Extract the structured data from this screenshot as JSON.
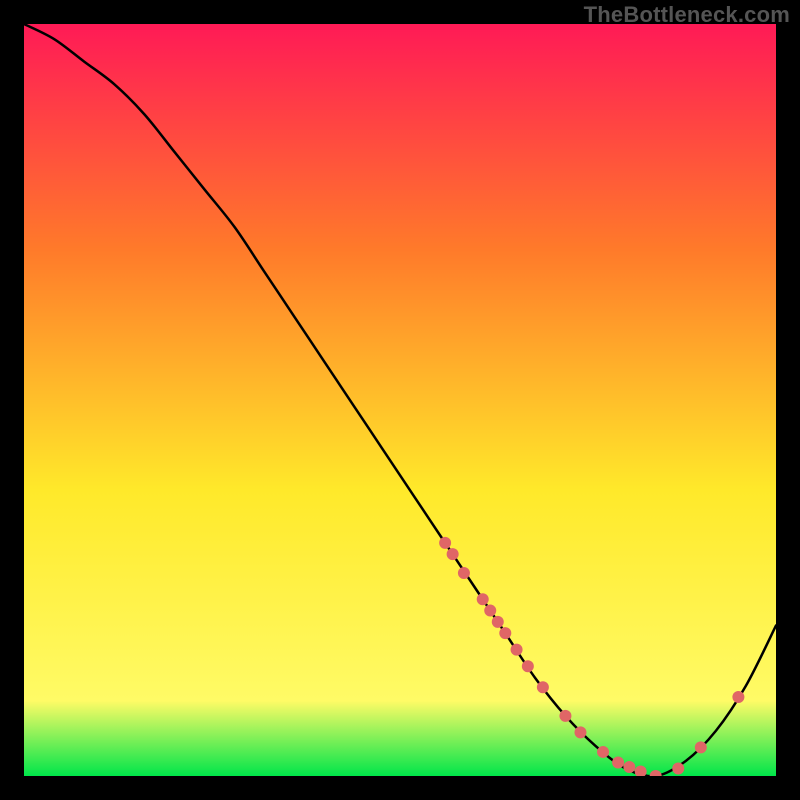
{
  "watermark": "TheBottleneck.com",
  "chart_data": {
    "type": "line",
    "title": "",
    "xlabel": "",
    "ylabel": "",
    "xlim": [
      0,
      100
    ],
    "ylim": [
      0,
      100
    ],
    "grid": false,
    "legend": false,
    "background_gradient": {
      "top": "#ff1a56",
      "mid_upper": "#ff7a2a",
      "mid": "#ffe92a",
      "mid_lower": "#fffb66",
      "bottom": "#00e54a"
    },
    "series": [
      {
        "name": "bottleneck-curve",
        "color": "#000000",
        "x": [
          0,
          4,
          8,
          12,
          16,
          20,
          24,
          28,
          32,
          36,
          40,
          44,
          48,
          52,
          56,
          60,
          64,
          68,
          72,
          76,
          80,
          84,
          88,
          92,
          96,
          100
        ],
        "y": [
          100,
          98,
          95,
          92,
          88,
          83,
          78,
          73,
          67,
          61,
          55,
          49,
          43,
          37,
          31,
          25,
          19,
          13,
          8,
          4,
          1,
          0,
          2,
          6,
          12,
          20
        ]
      }
    ],
    "scatter": [
      {
        "name": "highlight-points",
        "color": "#e06666",
        "radius": 6,
        "points": [
          {
            "x": 56,
            "y": 31
          },
          {
            "x": 57,
            "y": 29.5
          },
          {
            "x": 58.5,
            "y": 27
          },
          {
            "x": 61,
            "y": 23.5
          },
          {
            "x": 62,
            "y": 22
          },
          {
            "x": 63,
            "y": 20.5
          },
          {
            "x": 64,
            "y": 19
          },
          {
            "x": 65.5,
            "y": 16.8
          },
          {
            "x": 67,
            "y": 14.6
          },
          {
            "x": 69,
            "y": 11.8
          },
          {
            "x": 72,
            "y": 8
          },
          {
            "x": 74,
            "y": 5.8
          },
          {
            "x": 77,
            "y": 3.2
          },
          {
            "x": 79,
            "y": 1.8
          },
          {
            "x": 80.5,
            "y": 1.2
          },
          {
            "x": 82,
            "y": 0.6
          },
          {
            "x": 84,
            "y": 0
          },
          {
            "x": 87,
            "y": 1
          },
          {
            "x": 90,
            "y": 3.8
          },
          {
            "x": 95,
            "y": 10.5
          }
        ]
      }
    ]
  }
}
